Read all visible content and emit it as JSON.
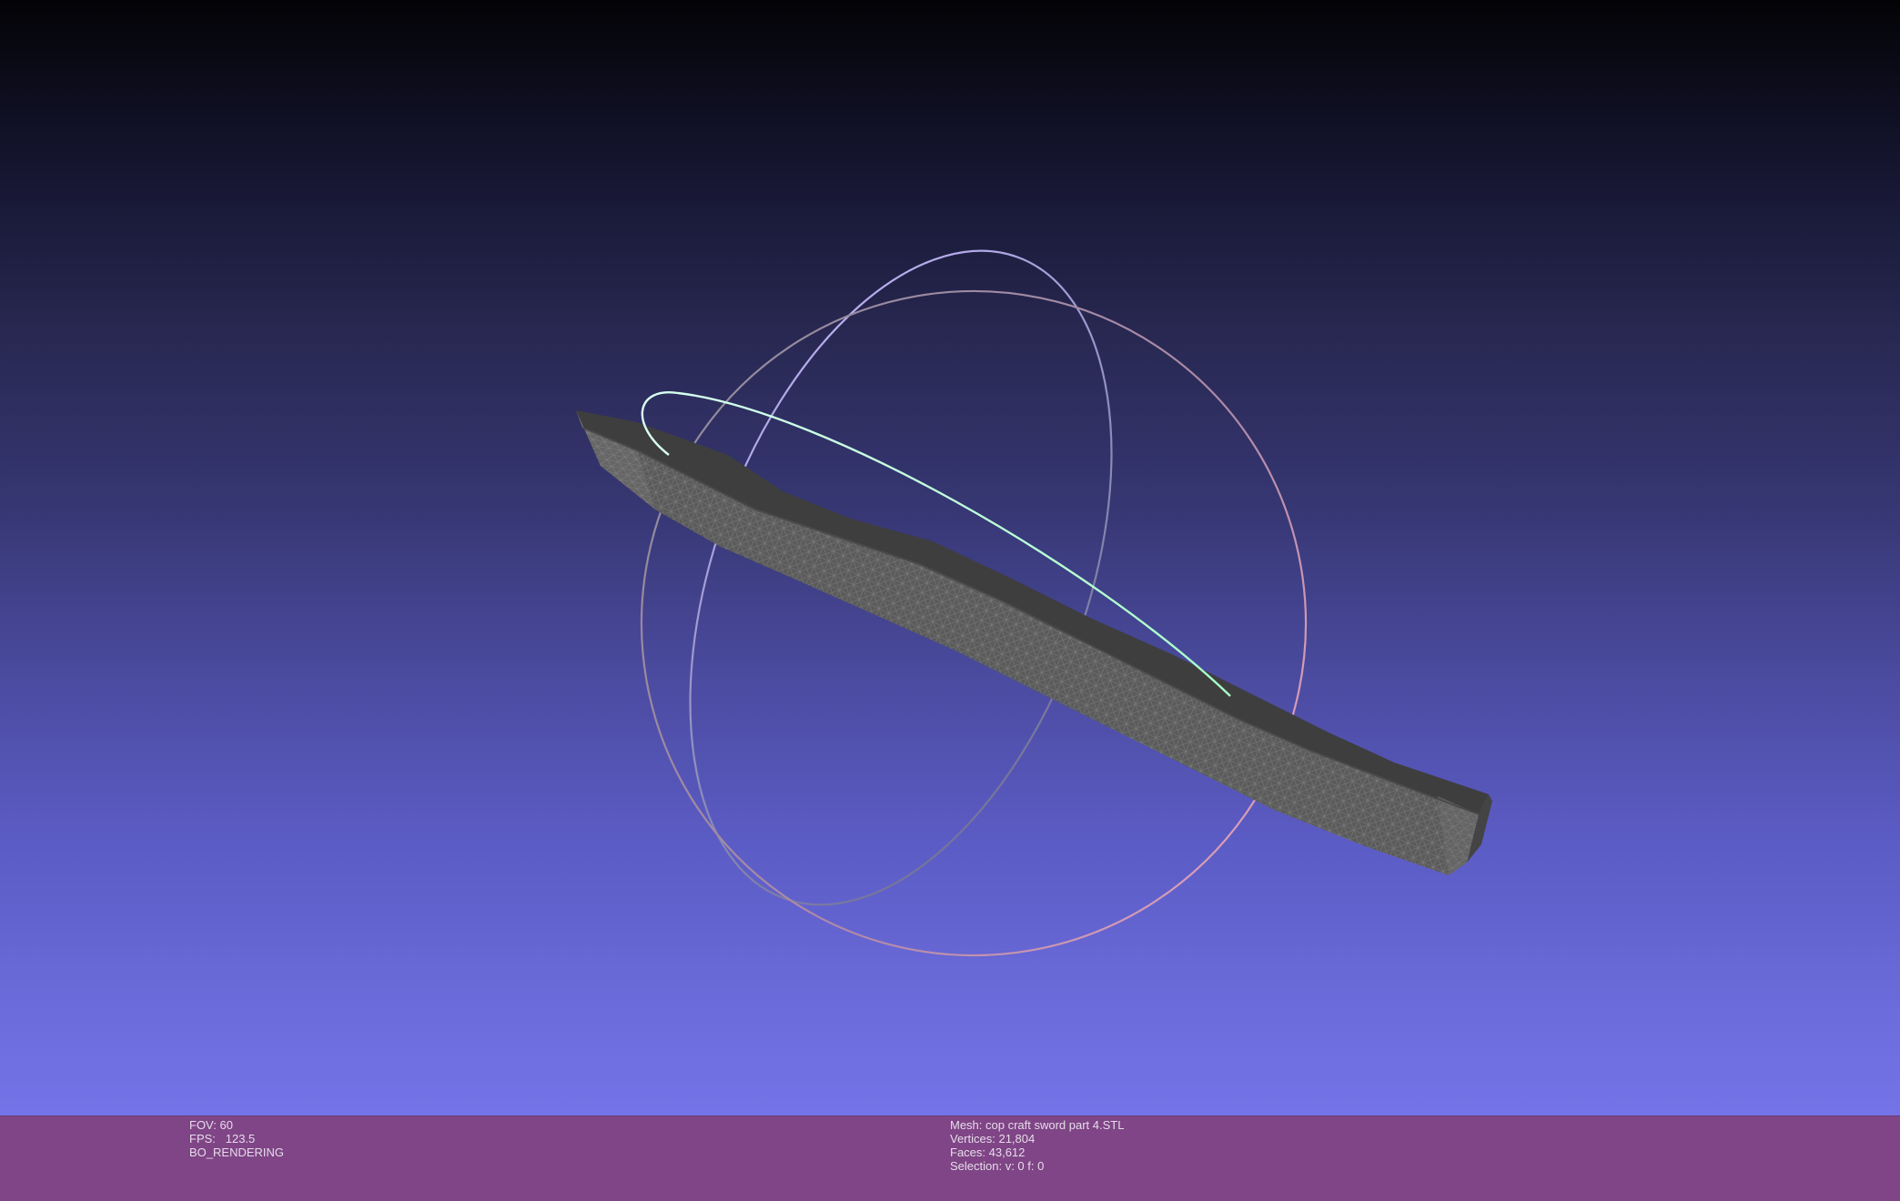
{
  "viewport": {
    "name": "3D mesh viewport",
    "model": "sword-blade-mesh",
    "gizmo": "trackball-rotation-rings"
  },
  "status": {
    "fov": "FOV: 60",
    "fps": "FPS:   123.5",
    "render_mode": "BO_RENDERING",
    "mesh": "Mesh: cop craft sword part 4.STL",
    "vertices": "Vertices: 21,804",
    "faces": "Faces: 43,612",
    "selection": "Selection: v: 0 f: 0"
  },
  "colors": {
    "status_bar": "#7f4586",
    "mesh": "#4a4a4a",
    "ring_x": "#e0a0c0",
    "ring_y": "#b8b8ff",
    "ring_z": "#b8ffd8"
  }
}
